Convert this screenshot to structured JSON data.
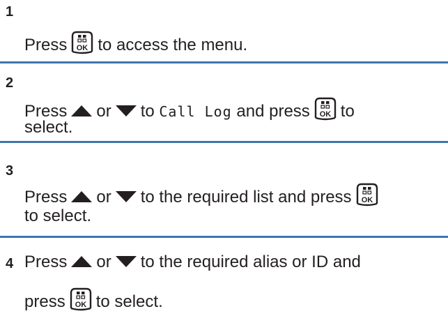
{
  "steps": [
    {
      "number": "1",
      "line1": {
        "before_key": "Press",
        "after_key": "to access the menu."
      }
    },
    {
      "number": "2",
      "line1": {
        "before_up": "Press",
        "between": "or",
        "after_down": "to",
        "code": "Call Log",
        "before_key": "and press",
        "after_key": "to"
      },
      "line2": "select."
    },
    {
      "number": "3",
      "line1": {
        "before_up": "Press",
        "between": "or",
        "after_down": "to the required list and press"
      },
      "line2": "to select."
    },
    {
      "number": "4",
      "line1": {
        "before_up": "Press",
        "between": "or",
        "after_down": "to the required alias or ID and"
      },
      "line2": {
        "before_key": "press",
        "after_key": "to select."
      }
    }
  ],
  "icons": {
    "ok_key": "menu-ok-key-icon",
    "up": "up-arrow-icon",
    "down": "down-arrow-icon"
  },
  "colors": {
    "divider": "#3f75ae",
    "text": "#231f20"
  }
}
